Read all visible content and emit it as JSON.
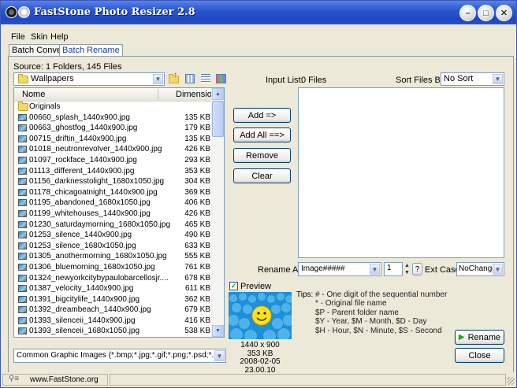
{
  "window": {
    "title": "FastStone Photo Resizer 2.8"
  },
  "menu": [
    "File",
    "Skin",
    "Help"
  ],
  "tabs": [
    "Batch Convert",
    "Batch Rename"
  ],
  "source": {
    "summary": "Source: 1 Folders, 145 Files",
    "folder": "Wallpapers"
  },
  "file_list": {
    "columns": [
      "Nome",
      "Dimensione"
    ],
    "folder_row": "Originals",
    "rows": [
      {
        "name": "00660_splash_1440x900.jpg",
        "size": "135 KB"
      },
      {
        "name": "00663_ghostfog_1440x900.jpg",
        "size": "179 KB"
      },
      {
        "name": "00715_driftin_1440x900.jpg",
        "size": "135 KB"
      },
      {
        "name": "01018_neutronrevolver_1440x900.jpg",
        "size": "426 KB"
      },
      {
        "name": "01097_rockface_1440x900.jpg",
        "size": "293 KB"
      },
      {
        "name": "01113_different_1440x900.jpg",
        "size": "353 KB"
      },
      {
        "name": "01156_darknesstolight_1680x1050.jpg",
        "size": "304 KB"
      },
      {
        "name": "01178_chicagoatnight_1440x900.jpg",
        "size": "369 KB"
      },
      {
        "name": "01195_abandoned_1680x1050.jpg",
        "size": "406 KB"
      },
      {
        "name": "01199_whitehouses_1440x900.jpg",
        "size": "426 KB"
      },
      {
        "name": "01230_saturdaymorning_1680x1050.jpg",
        "size": "465 KB"
      },
      {
        "name": "01253_silence_1440x900.jpg",
        "size": "490 KB"
      },
      {
        "name": "01253_silence_1680x1050.jpg",
        "size": "633 KB"
      },
      {
        "name": "01305_anothermorning_1680x1050.jpg",
        "size": "555 KB"
      },
      {
        "name": "01306_bluemorning_1680x1050.jpg",
        "size": "761 KB"
      },
      {
        "name": "01324_newyorkcitybypaulobarcellosjr....",
        "size": "678 KB"
      },
      {
        "name": "01387_velocity_1440x900.jpg",
        "size": "611 KB"
      },
      {
        "name": "01391_bigcitylife_1440x900.jpg",
        "size": "362 KB"
      },
      {
        "name": "01392_dreambeach_1440x900.jpg",
        "size": "679 KB"
      },
      {
        "name": "01393_silenceii_1440x900.jpg",
        "size": "416 KB"
      },
      {
        "name": "01393_silenceii_1680x1050.jpg",
        "size": "538 KB"
      }
    ]
  },
  "filter": "Common Graphic Images (*.bmp;*.jpg;*.gif;*.png;*.psd;*.tif;*.tiff;*.p",
  "buttons": {
    "add": "Add =>",
    "add_all": "Add All ==>",
    "remove": "Remove",
    "clear": "Clear",
    "rename": "Rename",
    "close": "Close"
  },
  "input_list": {
    "label": "Input List:",
    "count": "0 Files"
  },
  "sort": {
    "label": "Sort Files By:",
    "value": "No Sort"
  },
  "rename": {
    "label": "Rename As:",
    "pattern": "Image#####",
    "start": "1",
    "help": "?",
    "ext_label": "Ext Case:",
    "ext_value": "NoChange"
  },
  "preview": {
    "label": "Preview",
    "checked": true,
    "dimensions": "1440 x 900",
    "filesize": "353 KB",
    "date": "2008-02-05 23.00.10"
  },
  "tips": {
    "label": "Tips:",
    "lines": [
      "#  - One digit of the sequential number",
      "*   - Original file name",
      "$P - Parent folder name",
      "$Y - Year,     $M - Month,     $D - Day",
      "$H - Hour,     $N - Minute,    $S - Second"
    ]
  },
  "status": {
    "website": "www.FastStone.org"
  }
}
